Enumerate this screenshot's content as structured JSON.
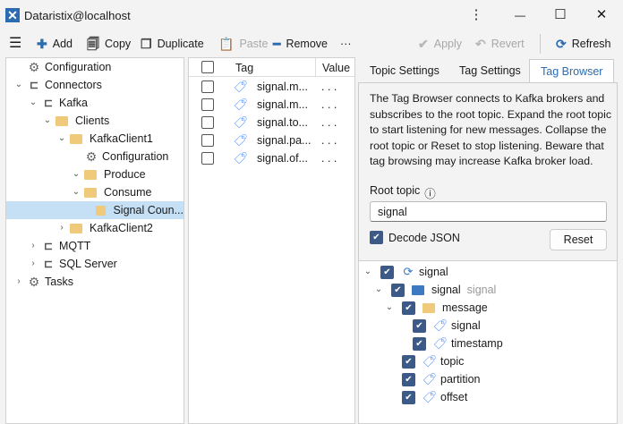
{
  "window": {
    "title": "Dataristix@localhost",
    "menu_icon": "⋮",
    "minimize": "—",
    "maximize": "☐",
    "close": "✕"
  },
  "toolbar": {
    "add": "Add",
    "copy": "Copy",
    "duplicate": "Duplicate",
    "paste": "Paste",
    "remove": "Remove",
    "more": "···",
    "apply": "Apply",
    "revert": "Revert",
    "refresh": "Refresh"
  },
  "tree": [
    {
      "label": "Configuration",
      "level": 0,
      "icon": "gear",
      "chev": ""
    },
    {
      "label": "Connectors",
      "level": 0,
      "icon": "plug",
      "chev": "v"
    },
    {
      "label": "Kafka",
      "level": 1,
      "icon": "plug",
      "chev": "v"
    },
    {
      "label": "Clients",
      "level": 2,
      "icon": "folder",
      "chev": "v"
    },
    {
      "label": "KafkaClient1",
      "level": 3,
      "icon": "folder",
      "chev": "v"
    },
    {
      "label": "Configuration",
      "level": 4,
      "icon": "gear",
      "chev": ""
    },
    {
      "label": "Produce",
      "level": 4,
      "icon": "folder",
      "chev": "v"
    },
    {
      "label": "Consume",
      "level": 4,
      "icon": "folder",
      "chev": "v"
    },
    {
      "label": "Signal Coun...",
      "level": 5,
      "icon": "folder",
      "chev": "",
      "selected": true
    },
    {
      "label": "KafkaClient2",
      "level": 3,
      "icon": "folder",
      "chev": ">"
    },
    {
      "label": "MQTT",
      "level": 1,
      "icon": "plug",
      "chev": ">"
    },
    {
      "label": "SQL Server",
      "level": 1,
      "icon": "plug",
      "chev": ">"
    },
    {
      "label": "Tasks",
      "level": 0,
      "icon": "gears",
      "chev": ">"
    }
  ],
  "tag_list": {
    "headers": {
      "tag": "Tag",
      "value": "Value"
    },
    "rows": [
      {
        "tag": "signal.m...",
        "value": ". . ."
      },
      {
        "tag": "signal.m...",
        "value": ". . ."
      },
      {
        "tag": "signal.to...",
        "value": ". . ."
      },
      {
        "tag": "signal.pa...",
        "value": ". . ."
      },
      {
        "tag": "signal.of...",
        "value": ". . ."
      }
    ]
  },
  "tabs": [
    {
      "label": "Topic Settings"
    },
    {
      "label": "Tag Settings"
    },
    {
      "label": "Tag Browser",
      "active": true
    }
  ],
  "browser": {
    "description": "The Tag Browser connects to Kafka brokers and subscribes to the root topic. Expand the root topic to start listening for new messages. Collapse the root topic or Reset to stop listening. Beware that tag browsing may increase Kafka broker load.",
    "root_topic_label": "Root topic",
    "info_icon": "ⓘ",
    "root_topic_value": "signal",
    "decode_json_label": "Decode JSON",
    "decode_json_checked": true,
    "reset": "Reset",
    "tree": [
      {
        "label": "signal",
        "level": 0,
        "icon": "refresh",
        "chev": "v"
      },
      {
        "label": "signal",
        "extra": "signal",
        "level": 1,
        "icon": "folder-blue",
        "chev": "v"
      },
      {
        "label": "message",
        "level": 2,
        "icon": "folder",
        "chev": "v"
      },
      {
        "label": "signal",
        "level": 3,
        "icon": "tag",
        "chev": ""
      },
      {
        "label": "timestamp",
        "level": 3,
        "icon": "tag",
        "chev": ""
      },
      {
        "label": "topic",
        "level": 2,
        "icon": "tag",
        "chev": ""
      },
      {
        "label": "partition",
        "level": 2,
        "icon": "tag",
        "chev": ""
      },
      {
        "label": "offset",
        "level": 2,
        "icon": "tag",
        "chev": ""
      }
    ]
  }
}
